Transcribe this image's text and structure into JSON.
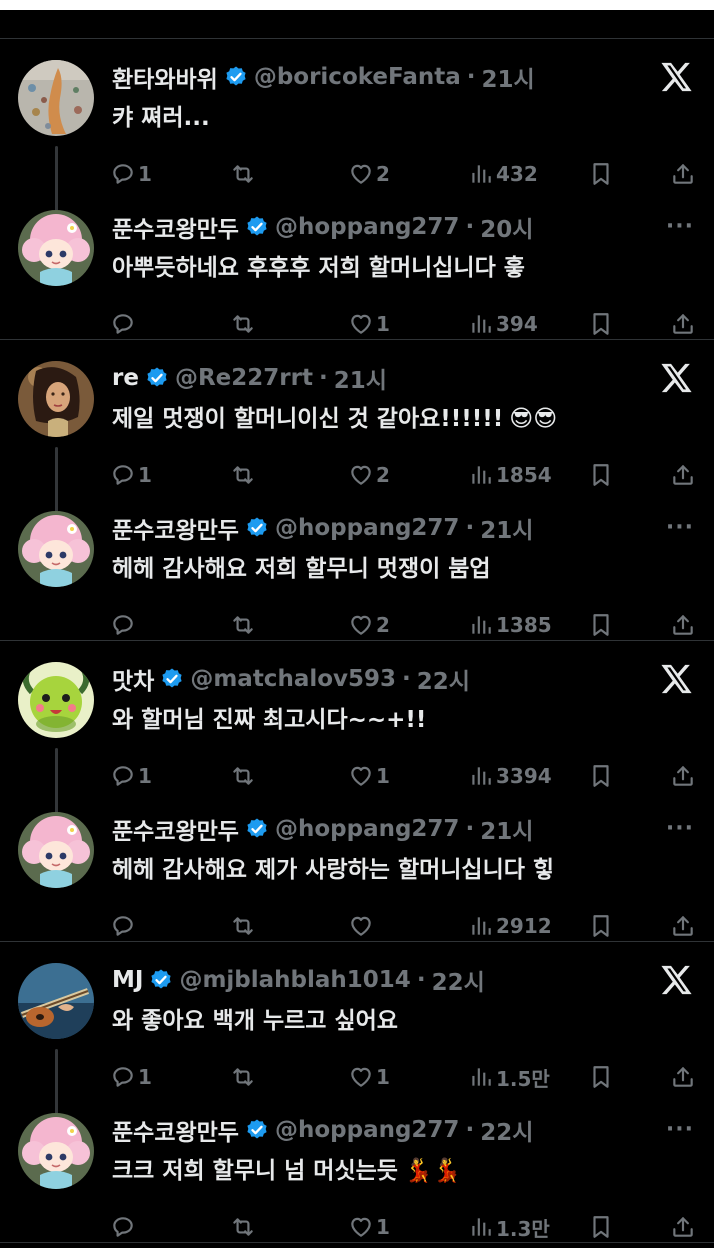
{
  "threads": [
    {
      "top": {
        "name": "환타와바위",
        "handle": "@boricokeFanta",
        "time": "21시",
        "text": "캬 쪄러...",
        "emoji": "",
        "replies": "1",
        "retweets": "",
        "likes": "2",
        "views": "432",
        "avatar": "avatar-photo-wall"
      },
      "reply": {
        "name": "푼수코왕만두",
        "handle": "@hoppang277",
        "time": "20시",
        "text": "아뿌듯하네요 후후후 저희 할머니십니다 흫",
        "emoji": "",
        "replies": "",
        "retweets": "",
        "likes": "1",
        "views": "394",
        "avatar": "avatar-pink-anime"
      }
    },
    {
      "top": {
        "name": "re",
        "handle": "@Re227rrt",
        "time": "21시",
        "text": "제일 멋쟁이 할머니이신 것 같아요!!!!!!",
        "emoji": "😎😎",
        "replies": "1",
        "retweets": "",
        "likes": "2",
        "views": "1854",
        "avatar": "avatar-woman-photo"
      },
      "reply": {
        "name": "푼수코왕만두",
        "handle": "@hoppang277",
        "time": "21시",
        "text": "헤헤 감사해요 저희 할무니 멋쟁이 붐업",
        "emoji": "",
        "replies": "",
        "retweets": "",
        "likes": "2",
        "views": "1385",
        "avatar": "avatar-pink-anime"
      }
    },
    {
      "top": {
        "name": "맛차",
        "handle": "@matchalov593",
        "time": "22시",
        "text": "와 할머님 진짜 최고시다~~+!!",
        "emoji": "",
        "replies": "1",
        "retweets": "",
        "likes": "1",
        "views": "3394",
        "avatar": "avatar-green-character"
      },
      "reply": {
        "name": "푼수코왕만두",
        "handle": "@hoppang277",
        "time": "21시",
        "text": "헤헤 감사해요 제가 사랑하는 할머니십니다 힣",
        "emoji": "",
        "replies": "",
        "retweets": "",
        "likes": "",
        "views": "2912",
        "avatar": "avatar-pink-anime"
      }
    },
    {
      "top": {
        "name": "MJ",
        "handle": "@mjblahblah1014",
        "time": "22시",
        "text": "와 좋아요 백개 누르고 싶어요",
        "emoji": "",
        "replies": "1",
        "retweets": "",
        "likes": "1",
        "views": "1.5만",
        "avatar": "avatar-guitar-photo"
      },
      "reply": {
        "name": "푼수코왕만두",
        "handle": "@hoppang277",
        "time": "22시",
        "text": "크크 저희 할무니 넘 머싯는듯",
        "emoji": "💃💃",
        "replies": "",
        "retweets": "",
        "likes": "1",
        "views": "1.3만",
        "avatar": "avatar-pink-anime"
      }
    }
  ],
  "colors": {
    "background": "#000000",
    "primary_text": "#e7e9ea",
    "secondary_text": "#71767b",
    "divider": "#2f3336",
    "verified": "#1d9bf0"
  },
  "icons": {
    "x_logo": "x-logo-icon",
    "more": "more-icon",
    "reply": "reply-icon",
    "retweet": "retweet-icon",
    "like": "heart-icon",
    "views": "views-icon",
    "bookmark": "bookmark-icon",
    "share": "share-icon",
    "verified": "verified-badge-icon"
  }
}
